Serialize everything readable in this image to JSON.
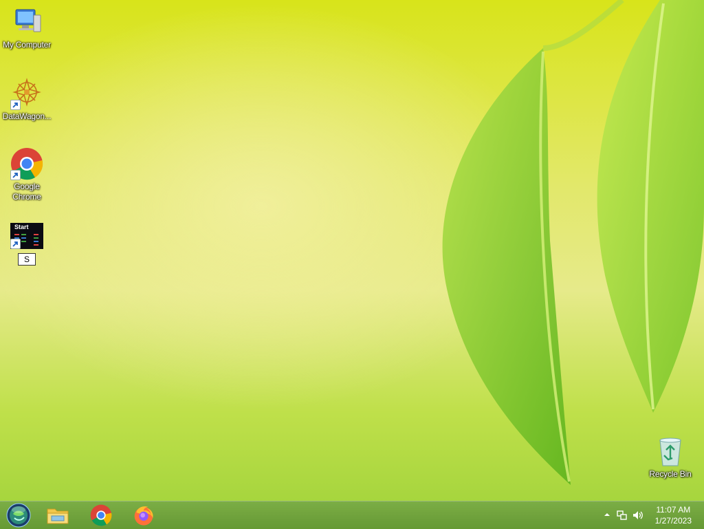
{
  "desktop": {
    "icons": [
      {
        "label": "My Computer",
        "icon": "computer-icon"
      },
      {
        "label": "DataWagon...",
        "icon": "datawagon-icon"
      },
      {
        "label": "Google Chrome",
        "icon": "chrome-icon"
      },
      {
        "label": "S",
        "icon": "start-app-icon",
        "renaming": true,
        "thumb_text": "Start"
      },
      {
        "label": "Recycle Bin",
        "icon": "recycle-bin-icon"
      }
    ]
  },
  "taskbar": {
    "start_button": {
      "icon": "start-orb-icon"
    },
    "pinned": [
      {
        "name": "File Explorer",
        "icon": "file-explorer-icon"
      },
      {
        "name": "Google Chrome",
        "icon": "chrome-icon"
      },
      {
        "name": "Firefox",
        "icon": "firefox-icon"
      }
    ],
    "tray": {
      "overflow_icon": "chevron-up-icon",
      "network_icon": "network-icon",
      "volume_icon": "volume-icon",
      "time": "11:07 AM",
      "date": "1/27/2023"
    }
  },
  "colors": {
    "taskbar": "#6f9e44",
    "wallpaper_top": "#d8e41a",
    "wallpaper_bottom": "#9fd23a"
  }
}
